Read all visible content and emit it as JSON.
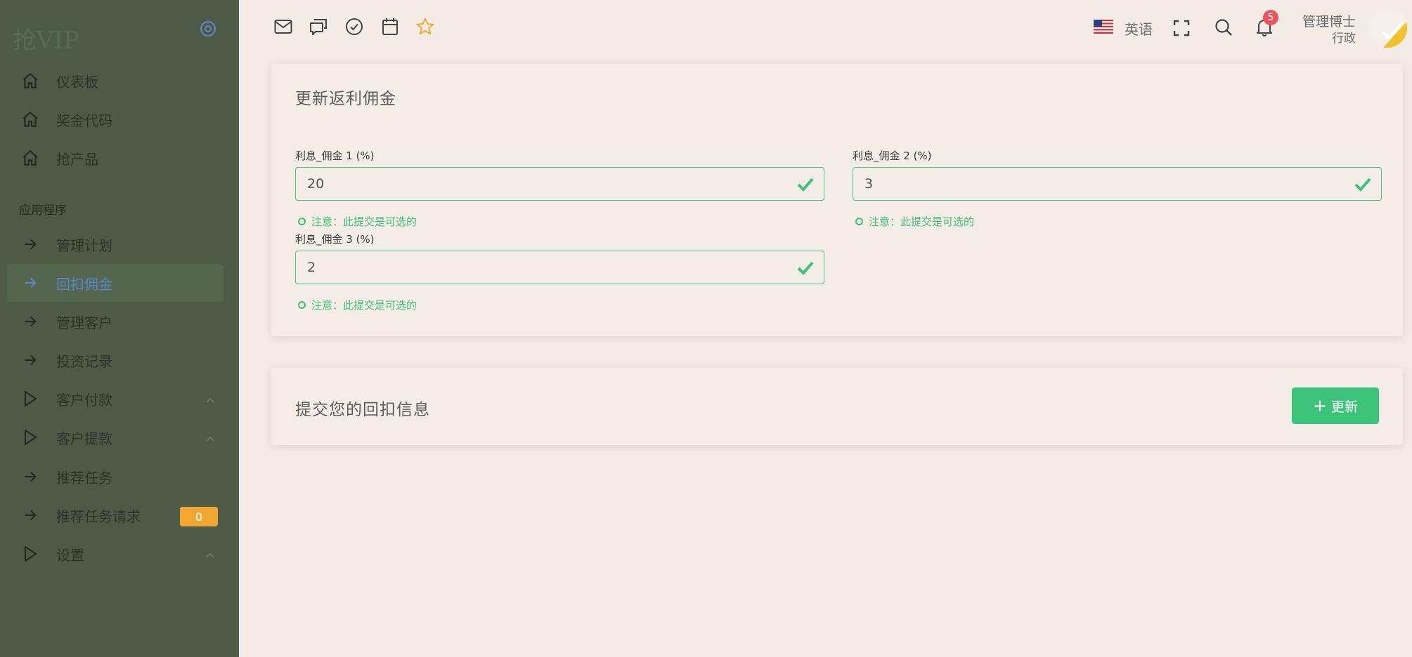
{
  "brand": {
    "name": "抢VIP"
  },
  "sidebar": {
    "top_items": [
      {
        "label": "仪表板",
        "icon": "home-icon"
      },
      {
        "label": "奖金代码",
        "icon": "home-icon"
      },
      {
        "label": "抢产品",
        "icon": "home-icon"
      }
    ],
    "section_heading": "应用程序",
    "app_items": [
      {
        "label": "管理计划",
        "icon": "arrow-right-icon"
      },
      {
        "label": "回扣佣金",
        "icon": "arrow-right-icon",
        "active": true
      },
      {
        "label": "管理客户",
        "icon": "arrow-right-icon"
      },
      {
        "label": "投资记录",
        "icon": "arrow-right-icon"
      },
      {
        "label": "客户付款",
        "icon": "play-icon",
        "has_chevron": true
      },
      {
        "label": "客户提款",
        "icon": "play-icon",
        "has_chevron": true
      },
      {
        "label": "推荐任务",
        "icon": "arrow-right-icon"
      },
      {
        "label": "推荐任务请求",
        "icon": "arrow-right-icon",
        "badge": "0"
      },
      {
        "label": "设置",
        "icon": "play-icon",
        "has_chevron": true
      }
    ]
  },
  "topbar": {
    "quick_icons": [
      "mail-icon",
      "chat-icon",
      "check-circle-icon",
      "calendar-icon",
      "star-icon"
    ],
    "language": "英语",
    "notification_count": "5",
    "user": {
      "name": "管理博士",
      "role": "行政"
    }
  },
  "form_card": {
    "title": "更新返利佣金",
    "fields": [
      {
        "label": "利息_佣金 1 (%)",
        "value": "20",
        "hint": "注意：此提交是可选的"
      },
      {
        "label": "利息_佣金 2 (%)",
        "value": "3",
        "hint": "注意：此提交是可选的"
      },
      {
        "label": "利息_佣金 3 (%)",
        "value": "2",
        "hint": "注意：此提交是可选的"
      }
    ]
  },
  "submit_card": {
    "title": "提交您的回扣信息",
    "button_label": "更新"
  },
  "colors": {
    "sidebar_bg": "#4d5b46",
    "page_bg": "#f3ebe6",
    "success_green": "#3cc27a",
    "badge_orange": "#f0a832",
    "badge_red": "#e9535b",
    "active_blue": "#5b86c9"
  }
}
